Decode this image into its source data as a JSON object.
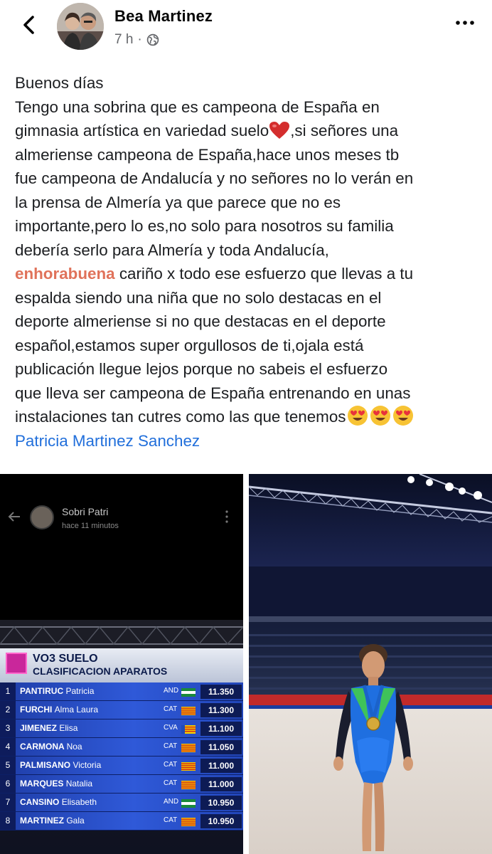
{
  "header": {
    "author": "Bea Martinez",
    "time": "7 h",
    "separator": "·",
    "icons": {
      "back": "chevron-left-icon",
      "audience": "globe-icon",
      "more": "more-horizontal-icon"
    }
  },
  "post": {
    "lines": [
      "Buenos días",
      "Tengo una sobrina que es campeona de España en",
      "gimnasia artística en variedad suelo",
      ",si señores una",
      "almeriense campeona de España,hace unos meses tb",
      "fue campeona de Andalucía y no señores no lo verán en",
      "la prensa de Almería ya que parece que no es",
      "importante,pero lo es,no solo para nosotros su familia",
      "debería serlo para Almería y toda Andalucía,",
      "enhorabuena",
      " cariño x todo ese esfuerzo que llevas a tu",
      "espalda siendo una niña que no solo destacas en el",
      "deporte almeriense si no que destacas en el deporte",
      "español,estamos super orgullosos de ti,ojala está",
      "publicación llegue lejos porque no sabeis el esfuerzo",
      "que lleva ser campeona de España entrenando en unas",
      "instalaciones tan cutres como las que tenemos"
    ],
    "tagged": "Patricia Martinez Sanchez",
    "emoji": [
      "heart-emoji",
      "heart-eyes-emoji"
    ],
    "colors": {
      "highlight": "#e0725a",
      "link": "#216fdb"
    }
  },
  "story": {
    "name": "Sobri Patri",
    "time": "hace 11 minutos"
  },
  "scoreboard": {
    "title": "VO3 SUELO",
    "subtitle": "CLASIFICACION APARATOS",
    "rows": [
      {
        "rank": "1",
        "surname": "PANTIRUC",
        "given": "Patricia",
        "team": "AND",
        "score": "11.350"
      },
      {
        "rank": "2",
        "surname": "FURCHI",
        "given": "Alma Laura",
        "team": "CAT",
        "score": "11.300"
      },
      {
        "rank": "3",
        "surname": "JIMENEZ",
        "given": "Elisa",
        "team": "CVA",
        "score": "11.100"
      },
      {
        "rank": "4",
        "surname": "CARMONA",
        "given": "Noa",
        "team": "CAT",
        "score": "11.050"
      },
      {
        "rank": "5",
        "surname": "PALMISANO",
        "given": "Victoria",
        "team": "CAT",
        "score": "11.000"
      },
      {
        "rank": "6",
        "surname": "MARQUES",
        "given": "Natalia",
        "team": "CAT",
        "score": "11.000"
      },
      {
        "rank": "7",
        "surname": "CANSINO",
        "given": "Elisabeth",
        "team": "AND",
        "score": "10.950"
      },
      {
        "rank": "8",
        "surname": "MARTINEZ",
        "given": "Gala",
        "team": "CAT",
        "score": "10.950"
      }
    ]
  }
}
